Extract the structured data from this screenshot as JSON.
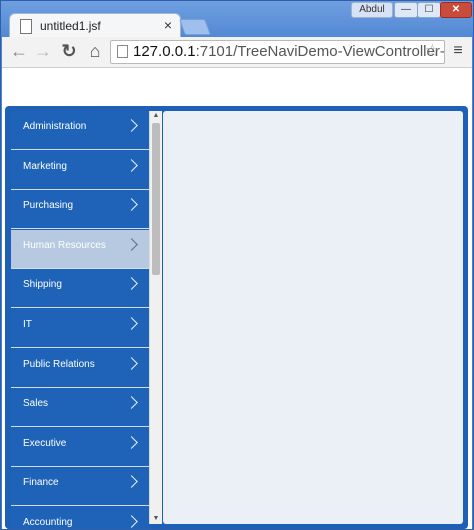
{
  "browser": {
    "tab_title": "untitled1.jsf",
    "tab_close": "×",
    "user": "Abdul",
    "win_min": "—",
    "win_max": "☐",
    "win_close": "✕",
    "url_host": "127.0.0.1",
    "url_rest": ":7101/TreeNaviDemo-ViewController-co",
    "back_icon": "←",
    "forward_icon": "→",
    "reload_icon": "↻",
    "home_icon": "⌂",
    "star_icon": "☆",
    "menu_icon": "≡"
  },
  "nav": {
    "selected_index": 3,
    "items": [
      {
        "label": "Administration"
      },
      {
        "label": "Marketing"
      },
      {
        "label": "Purchasing"
      },
      {
        "label": "Human Resources"
      },
      {
        "label": "Shipping"
      },
      {
        "label": "IT"
      },
      {
        "label": "Public Relations"
      },
      {
        "label": "Sales"
      },
      {
        "label": "Executive"
      },
      {
        "label": "Finance"
      },
      {
        "label": "Accounting"
      }
    ]
  },
  "scrollbar": {
    "up": "▲",
    "down": "▼"
  },
  "colors": {
    "nav_bg": "#1e63b8",
    "nav_selected": "#b6c9e1",
    "frame": "#1d60b6",
    "content_bg": "#ebf0f6"
  }
}
